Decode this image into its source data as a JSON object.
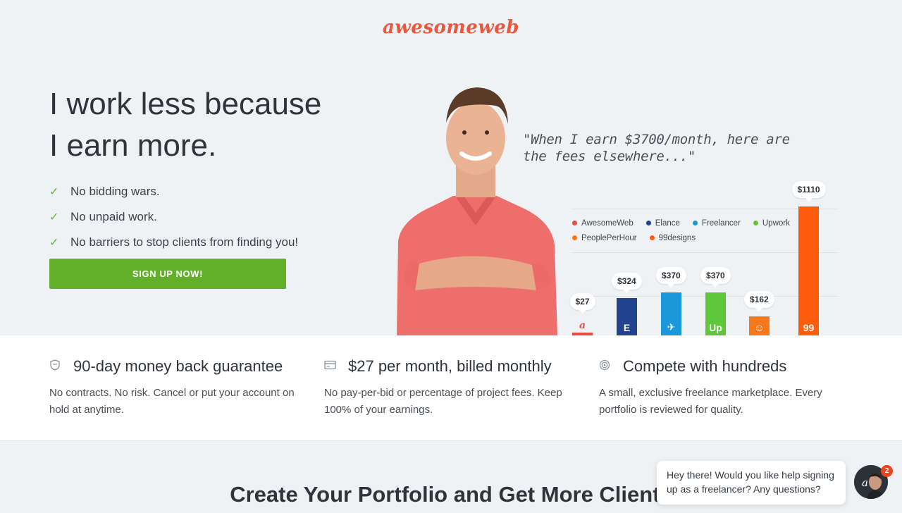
{
  "brand": {
    "logo_text": "awesomeweb",
    "accent": "#e9573f"
  },
  "hero": {
    "title_line1": "I work less because",
    "title_line2": "I earn more.",
    "benefits": [
      "No bidding wars.",
      "No unpaid work.",
      "No barriers to stop clients from finding you!"
    ],
    "cta_label": "SIGN UP NOW!",
    "cta_color": "#62b029",
    "quote": "\"When I earn $3700/month, here are the fees elsewhere...\""
  },
  "chart_data": {
    "type": "bar",
    "categories": [
      "AwesomeWeb",
      "Elance",
      "Freelancer",
      "Upwork",
      "PeoplePerHour",
      "99designs"
    ],
    "values": [
      27,
      324,
      370,
      370,
      162,
      1110
    ],
    "value_labels": [
      "$27",
      "$324",
      "$370",
      "$370",
      "$162",
      "$1110"
    ],
    "bar_icons": [
      "a",
      "E",
      "✈",
      "Up",
      "☺",
      "99"
    ],
    "colors": [
      "#e74c3c",
      "#22428f",
      "#1a98da",
      "#5fc83a",
      "#f7771b",
      "#fc5c0c"
    ],
    "legend": [
      {
        "label": "AwesomeWeb",
        "color": "#e74c3c"
      },
      {
        "label": "Elance",
        "color": "#22428f"
      },
      {
        "label": "Freelancer",
        "color": "#1a98da"
      },
      {
        "label": "Upwork",
        "color": "#5fc83a"
      },
      {
        "label": "PeoplePerHour",
        "color": "#f7771b"
      },
      {
        "label": "99designs",
        "color": "#fc5c0c"
      }
    ],
    "legend_placement": "top",
    "ylim": [
      0,
      1200
    ],
    "grid": true
  },
  "features": [
    {
      "icon": "shield-icon",
      "title": "90-day money back guarantee",
      "desc": "No contracts. No risk. Cancel or put your account on hold at anytime."
    },
    {
      "icon": "card-icon",
      "title": "$27 per month, billed monthly",
      "desc": "No pay-per-bid or percentage of project fees. Keep 100% of your earnings."
    },
    {
      "icon": "target-icon",
      "title": "Compete with hundreds",
      "desc": "A small, exclusive freelance marketplace. Every portfolio is reviewed for quality."
    }
  ],
  "section": {
    "title": "Create Your Portfolio and Get More Clients"
  },
  "chat": {
    "message": "Hey there! Would you like help signing up as a freelancer? Any questions?",
    "badge_count": "2",
    "avatar_letter": "a"
  }
}
